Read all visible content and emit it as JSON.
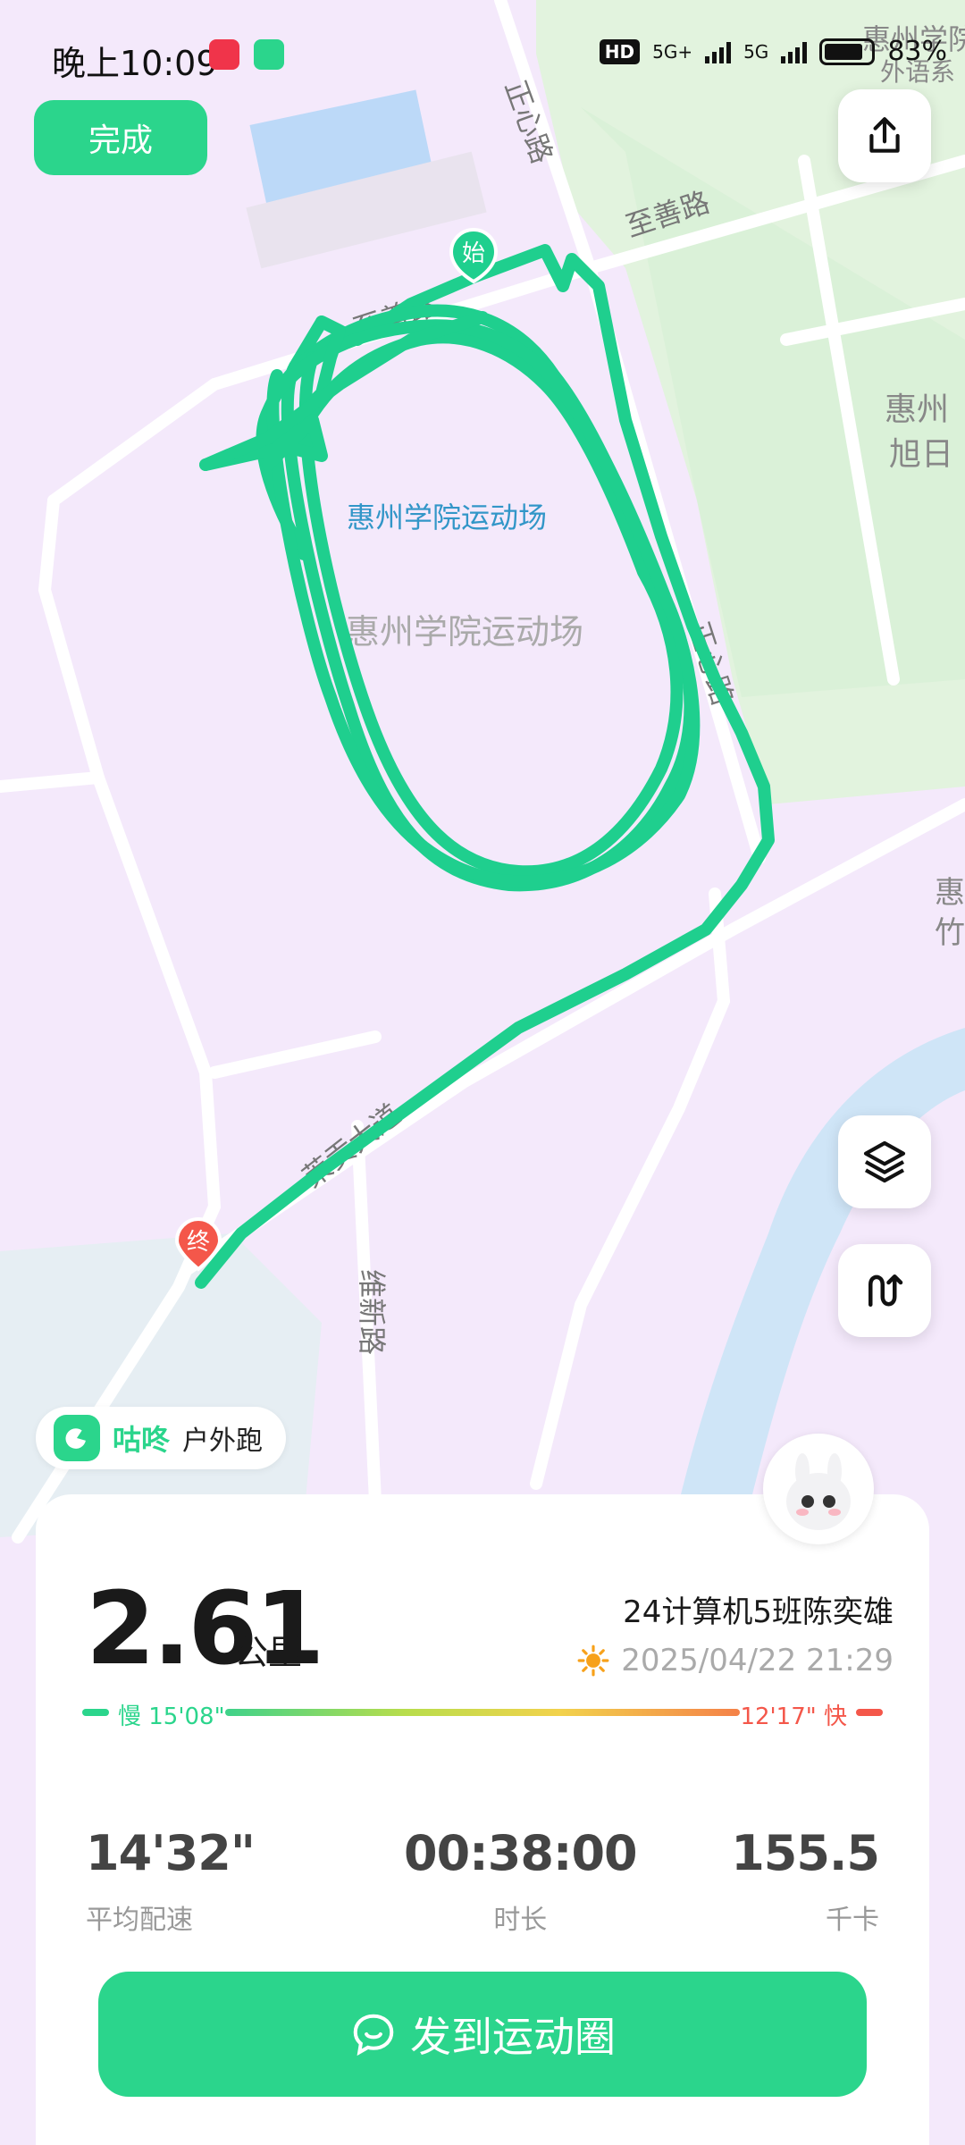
{
  "status_bar": {
    "time": "晚上10:09",
    "hd": "HD",
    "net1": "5G+",
    "net2": "5G",
    "battery": "83%"
  },
  "toolbar": {
    "done_label": "完成"
  },
  "map": {
    "roads": [
      "正心路",
      "至善路",
      "至善路",
      "正心路",
      "莱贡大道",
      "维新路"
    ],
    "place_label": "惠州学院运动场",
    "campus_labels": [
      "惠州学院",
      "外语系",
      "惠州",
      "旭日",
      "惠",
      "竹"
    ],
    "start_marker": "始",
    "end_marker": "终",
    "route_color": "#1fcf8e"
  },
  "brand": {
    "name": "咕咚",
    "mode": "户外跑"
  },
  "summary": {
    "distance": "2.61",
    "distance_unit": "公里",
    "user": "24计算机5班陈奕雄",
    "datetime": "2025/04/22 21:29",
    "pace_slow_label": "慢 15'08\"",
    "pace_fast_label": "12'17\" 快",
    "stats": [
      {
        "value": "14'32\"",
        "label": "平均配速"
      },
      {
        "value": "00:38:00",
        "label": "时长"
      },
      {
        "value": "155.5",
        "label": "千卡"
      }
    ]
  },
  "share_label": "发到运动圈",
  "colors": {
    "accent": "#2bd58c",
    "fast": "#f4574a"
  }
}
